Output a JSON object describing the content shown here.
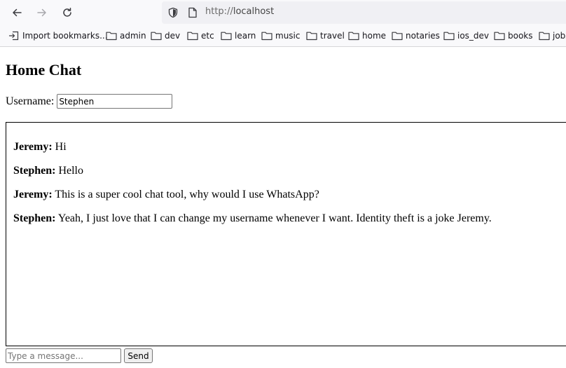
{
  "browser": {
    "url_scheme": "http://",
    "url_host": "localhost",
    "bookmarks": [
      {
        "label": "Import bookmarks...",
        "icon": "import-icon"
      },
      {
        "label": "admin",
        "icon": "folder-icon"
      },
      {
        "label": "dev",
        "icon": "folder-icon"
      },
      {
        "label": "etc",
        "icon": "folder-icon"
      },
      {
        "label": "learn",
        "icon": "folder-icon"
      },
      {
        "label": "music",
        "icon": "folder-icon"
      },
      {
        "label": "travel",
        "icon": "folder-icon"
      },
      {
        "label": "home",
        "icon": "folder-icon"
      },
      {
        "label": "notaries",
        "icon": "folder-icon"
      },
      {
        "label": "ios_dev",
        "icon": "folder-icon"
      },
      {
        "label": "books",
        "icon": "folder-icon"
      },
      {
        "label": "jobs",
        "icon": "folder-icon"
      }
    ]
  },
  "page": {
    "title": "Home Chat",
    "username_label": "Username:",
    "username_value": "Stephen"
  },
  "chat": {
    "messages": [
      {
        "user": "Jeremy:",
        "text": "Hi"
      },
      {
        "user": "Stephen:",
        "text": "Hello"
      },
      {
        "user": "Jeremy:",
        "text": "This is a super cool chat tool, why would I use WhatsApp?"
      },
      {
        "user": "Stephen:",
        "text": "Yeah, I just love that I can change my username whenever I want. Identity theft is a joke Jeremy."
      }
    ]
  },
  "composer": {
    "placeholder": "Type a message...",
    "send_label": "Send"
  }
}
